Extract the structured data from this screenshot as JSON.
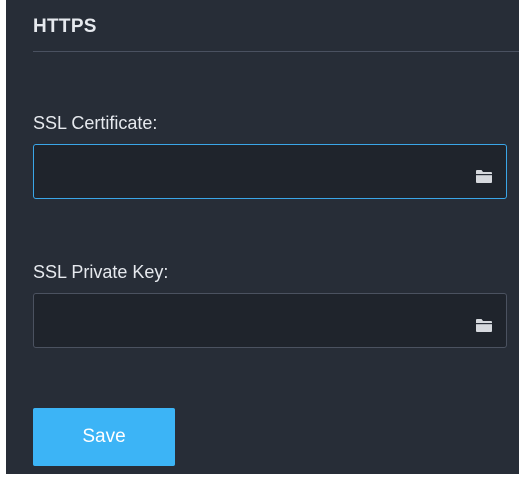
{
  "section": {
    "title": "HTTPS"
  },
  "fields": {
    "ssl_certificate": {
      "label": "SSL Certificate:",
      "value": "",
      "icon": "folder-icon"
    },
    "ssl_private_key": {
      "label": "SSL Private Key:",
      "value": "",
      "icon": "folder-icon"
    }
  },
  "actions": {
    "save_label": "Save"
  },
  "colors": {
    "panel_background": "#272d37",
    "field_background": "#1f242c",
    "focus_border": "#3aa6e8",
    "primary_button": "#3cb4f6"
  }
}
